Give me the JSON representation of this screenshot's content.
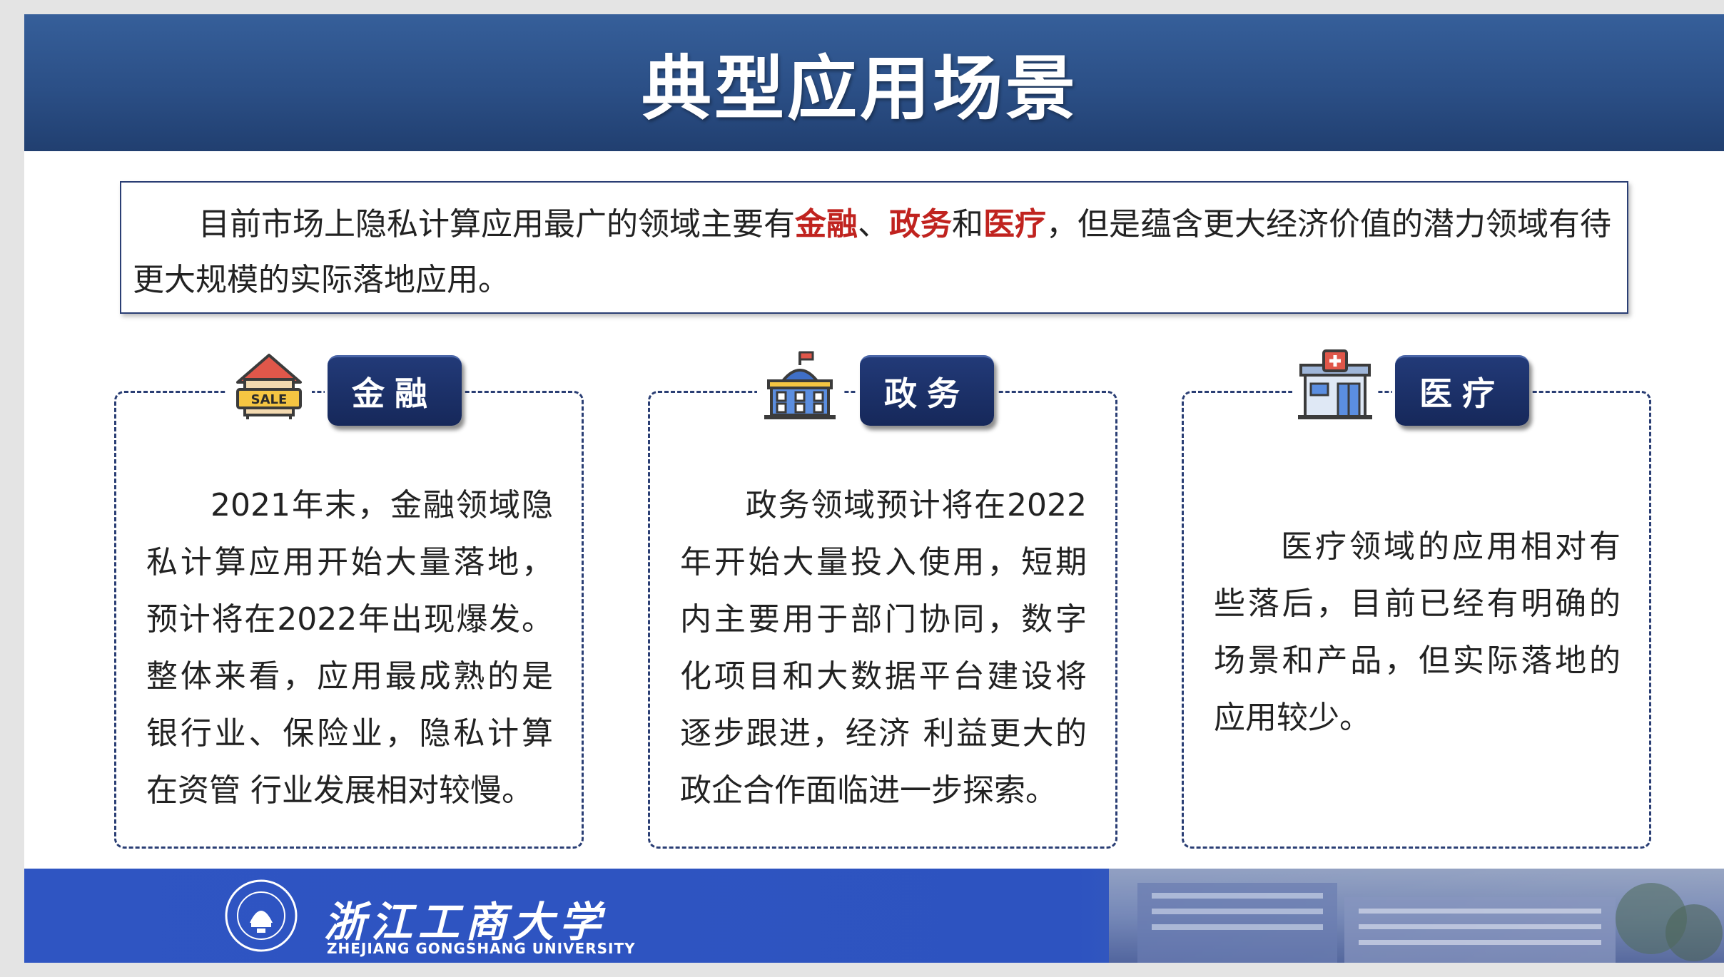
{
  "title": "典型应用场景",
  "intro": {
    "part1": "目前市场上隐私计算应用最广的领域主要有",
    "finance": "金融",
    "sep1": "、",
    "government": "政务",
    "sep2": "和",
    "medical": "医疗",
    "part2": "，但是蕴含更大经济价值的潜力领域有待更大规模的实际落地应用。"
  },
  "cards": [
    {
      "label": "金融",
      "icon": "house-sale-icon",
      "text": "2021年末，金融领域隐私计算应用开始大量落地，预计将在2022年出现爆发。整体来看，应用最成熟的是银行业、保险业，隐私计算在资管 行业发展相对较慢。"
    },
    {
      "label": "政务",
      "icon": "government-building-icon",
      "text": "政务领域预计将在2022年开始大量投入使用，短期内主要用于部门协同，数字化项目和大数据平台建设将逐步跟进，经济 利益更大的政企合作面临进一步探索。"
    },
    {
      "label": "医疗",
      "icon": "hospital-icon",
      "text": "医疗领域的应用相对有些落后，目前已经有明确的场景和产品，但实际落地的应用较少。"
    }
  ],
  "footer": {
    "university_cn": "浙江工商大学",
    "university_en": "ZHEJIANG GONGSHANG UNIVERSITY"
  },
  "colors": {
    "title_bar": "#2b4f86",
    "highlight": "#c0231f",
    "badge": "#1b2f66",
    "footer": "#2f55c2"
  }
}
